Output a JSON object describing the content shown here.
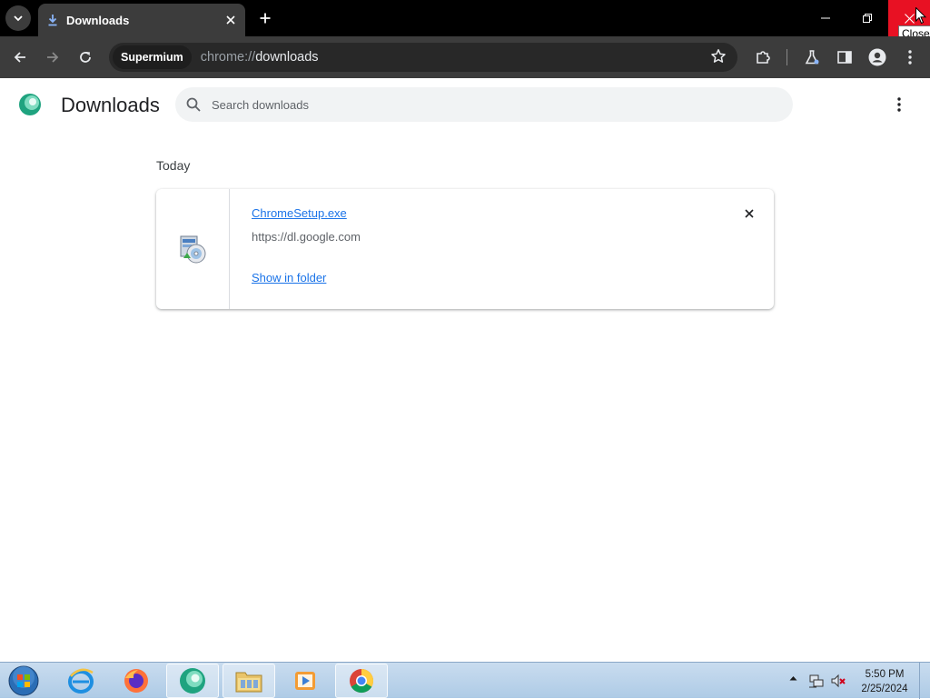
{
  "browser": {
    "tab": {
      "title": "Downloads"
    },
    "window_tooltip": "Close",
    "omnibox": {
      "chip": "Supermium",
      "url_scheme": "chrome://",
      "url_host": "downloads"
    }
  },
  "page": {
    "title": "Downloads",
    "search_placeholder": "Search downloads",
    "groups": [
      {
        "date_label": "Today",
        "items": [
          {
            "file_name": "ChromeSetup.exe",
            "source_url": "https://dl.google.com",
            "action_label": "Show in folder"
          }
        ]
      }
    ]
  },
  "taskbar": {
    "apps": [
      "start-orb",
      "internet-explorer",
      "firefox",
      "supermium",
      "file-explorer",
      "media-player",
      "chrome"
    ],
    "clock": {
      "time": "5:50 PM",
      "date": "2/25/2024"
    }
  },
  "colors": {
    "link": "#1a73e8",
    "close_hover": "#e81123",
    "toolbar": "#3c3c3c",
    "tabstrip": "#000000"
  }
}
